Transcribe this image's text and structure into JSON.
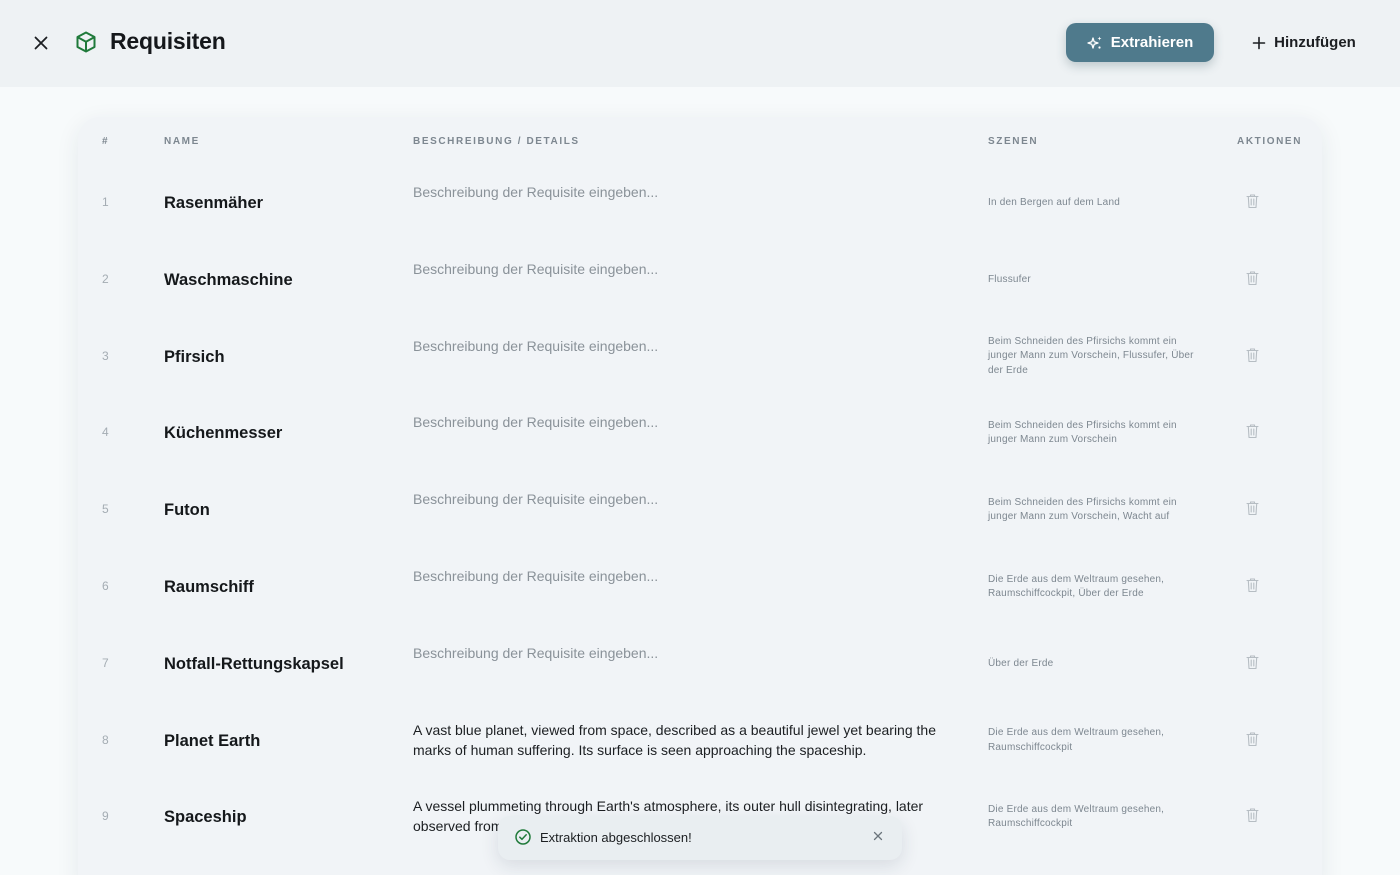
{
  "header": {
    "title": "Requisiten",
    "extract_label": "Extrahieren",
    "add_label": "Hinzufügen",
    "accent_color": "#4f7a8c",
    "icon_color": "#1f7a3a"
  },
  "table": {
    "columns": {
      "num": "#",
      "name": "NAME",
      "desc": "BESCHREIBUNG / DETAILS",
      "scenes": "SZENEN",
      "actions": "AKTIONEN"
    },
    "rows": [
      {
        "num": "1",
        "name": "Rasenmäher",
        "desc": "Beschreibung der Requisite eingeben...",
        "filled": false,
        "scenes": "In den Bergen auf dem Land"
      },
      {
        "num": "2",
        "name": "Waschmaschine",
        "desc": "Beschreibung der Requisite eingeben...",
        "filled": false,
        "scenes": "Flussufer"
      },
      {
        "num": "3",
        "name": "Pfirsich",
        "desc": "Beschreibung der Requisite eingeben...",
        "filled": false,
        "scenes": "Beim Schneiden des Pfirsichs kommt ein junger Mann zum Vorschein, Flussufer, Über der Erde"
      },
      {
        "num": "4",
        "name": "Küchenmesser",
        "desc": "Beschreibung der Requisite eingeben...",
        "filled": false,
        "scenes": "Beim Schneiden des Pfirsichs kommt ein junger Mann zum Vorschein"
      },
      {
        "num": "5",
        "name": "Futon",
        "desc": "Beschreibung der Requisite eingeben...",
        "filled": false,
        "scenes": "Beim Schneiden des Pfirsichs kommt ein junger Mann zum Vorschein, Wacht auf"
      },
      {
        "num": "6",
        "name": "Raumschiff",
        "desc": "Beschreibung der Requisite eingeben...",
        "filled": false,
        "scenes": "Die Erde aus dem Weltraum gesehen, Raumschiffcockpit, Über der Erde"
      },
      {
        "num": "7",
        "name": "Notfall-Rettungskapsel",
        "desc": "Beschreibung der Requisite eingeben...",
        "filled": false,
        "scenes": "Über der Erde"
      },
      {
        "num": "8",
        "name": "Planet Earth",
        "desc": "A vast blue planet, viewed from space, described as a beautiful jewel yet bearing the marks of human suffering. Its surface is seen approaching the spaceship.",
        "filled": true,
        "scenes": "Die Erde aus dem Weltraum gesehen, Raumschiffcockpit"
      },
      {
        "num": "9",
        "name": "Spaceship",
        "desc": "A vessel plummeting through Earth's atmosphere, its outer hull disintegrating, later observed from",
        "filled": true,
        "scenes": "Die Erde aus dem Weltraum gesehen, Raumschiffcockpit"
      }
    ]
  },
  "toast": {
    "message": "Extraktion abgeschlossen!",
    "status_color": "#1f7a3a"
  }
}
